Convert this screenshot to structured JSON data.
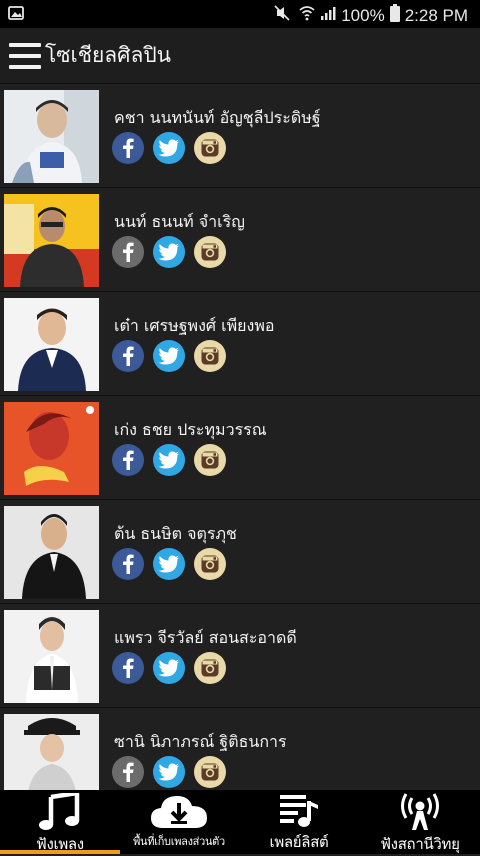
{
  "status_bar": {
    "battery": "100%",
    "time": "2:28 PM"
  },
  "app_bar": {
    "title": "โซเชียลศิลปิน"
  },
  "artists": [
    {
      "name": "คชา นนทนันท์ อัญชุลีประดิษฐ์",
      "facebook_active": true
    },
    {
      "name": "นนท์ ธนนท์ จำเริญ",
      "facebook_active": false
    },
    {
      "name": "เต๋า เศรษฐพงศ์ เพียงพอ",
      "facebook_active": true
    },
    {
      "name": "เก่ง ธชย ประทุมวรรณ",
      "facebook_active": true
    },
    {
      "name": "ต้น ธนษิต จตุรภุช",
      "facebook_active": true
    },
    {
      "name": "แพรว จีรวัลย์ สอนสะอาดดี",
      "facebook_active": true
    },
    {
      "name": "ซานิ นิภาภรณ์ ฐิติธนการ",
      "facebook_active": false
    }
  ],
  "bottom_nav": [
    {
      "label": "ฟังเพลง",
      "icon": "music-note-icon",
      "active": true
    },
    {
      "label": "พื้นที่เก็บเพลงส่วนตัว",
      "icon": "cloud-download-icon",
      "active": false
    },
    {
      "label": "เพลย์ลิสต์",
      "icon": "playlist-icon",
      "active": false
    },
    {
      "label": "ฟังสถานีวิทยุ",
      "icon": "radio-tower-icon",
      "active": false
    }
  ],
  "colors": {
    "background": "#1f1f1f",
    "facebook": "#3c5a97",
    "facebook_inactive": "#6b6b6b",
    "twitter": "#30a8e6",
    "instagram": "#e9d9a8",
    "active_tab": "#f39a1e"
  }
}
